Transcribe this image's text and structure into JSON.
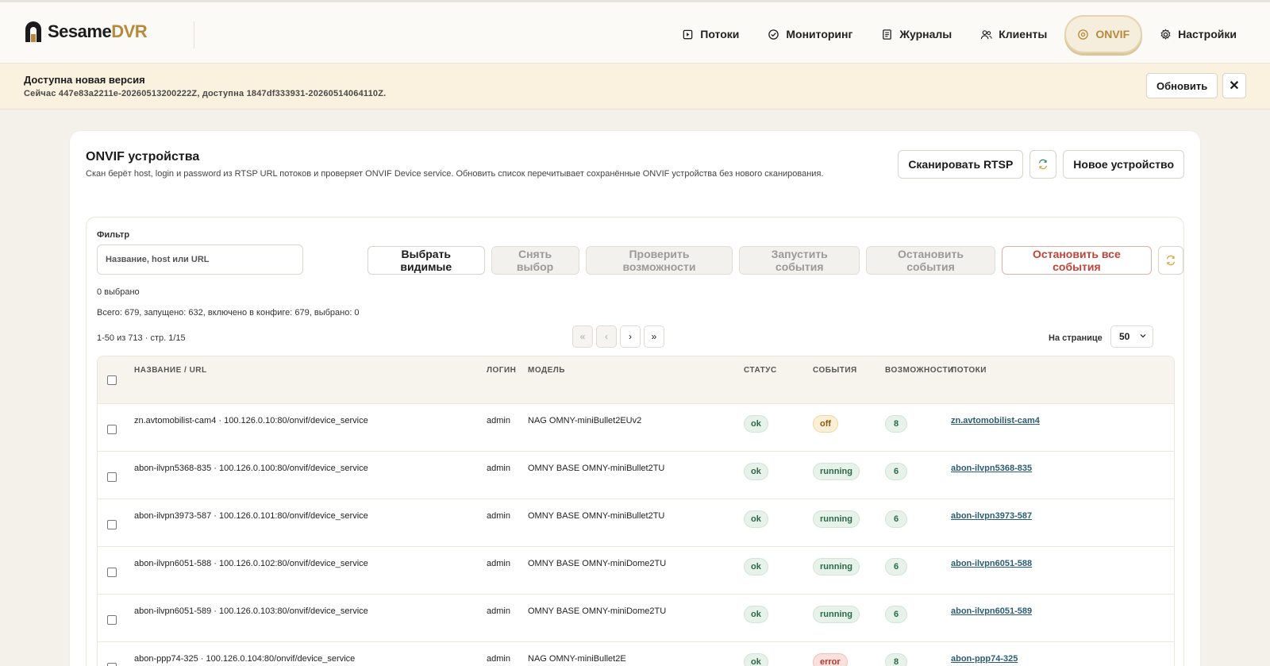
{
  "app": {
    "logo_main": "Sesame",
    "logo_accent": "DVR"
  },
  "nav": {
    "items": [
      {
        "label": "Потоки",
        "icon": "streams-icon"
      },
      {
        "label": "Мониторинг",
        "icon": "monitoring-icon"
      },
      {
        "label": "Журналы",
        "icon": "logs-icon"
      },
      {
        "label": "Клиенты",
        "icon": "clients-icon"
      },
      {
        "label": "ONVIF",
        "icon": "onvif-icon",
        "active": true
      },
      {
        "label": "Настройки",
        "icon": "settings-icon"
      }
    ]
  },
  "banner": {
    "title": "Доступна новая версия",
    "text": "Сейчас 447e83a2211e-20260513200222Z, доступна 1847df333931-20260514064110Z.",
    "update_label": "Обновить",
    "close_label": "✕"
  },
  "card": {
    "title": "ONVIF устройства",
    "description": "Скан берёт host, login и password из RTSP URL потоков и проверяет ONVIF Device service. Обновить список перечитывает сохранённые ONVIF устройства без нового сканирования.",
    "scan_label": "Сканировать RTSP",
    "refresh_icon": "refresh-icon",
    "new_device_label": "Новое устройство"
  },
  "filter": {
    "label": "Фильтр",
    "placeholder": "Название, host или URL",
    "select_visible": "Выбрать видимые",
    "clear_selection": "Снять выбор",
    "check_capabilities": "Проверить возможности",
    "start_events": "Запустить события",
    "stop_events": "Остановить события",
    "stop_all_events": "Остановить все события",
    "selected_count": "0 выбрано",
    "totals": "Всего: 679, запущено: 632, включено в конфиге: 679, выбрано: 0"
  },
  "pagination": {
    "range": "1-50 из 713 · стр. 1/15",
    "first": "«",
    "prev": "‹",
    "next": "›",
    "last": "»",
    "per_page_label": "На странице",
    "per_page_value": "50"
  },
  "table": {
    "headers": [
      "НАЗВАНИЕ / URL",
      "ЛОГИН",
      "МОДЕЛЬ",
      "СТАТУС",
      "СОБЫТИЯ",
      "ВОЗМОЖНОСТИ",
      "ПОТОКИ"
    ],
    "rows": [
      {
        "name": "zn.avtomobilist-cam4 · 100.126.0.10:80/onvif/device_service",
        "login": "admin",
        "model": "NAG OMNY-miniBullet2EUv2",
        "status": "ok",
        "events": "off",
        "caps": "8",
        "stream": "zn.avtomobilist-cam4"
      },
      {
        "name": "abon-ilvpn5368-835 · 100.126.0.100:80/onvif/device_service",
        "login": "admin",
        "model": "OMNY BASE OMNY-miniBullet2TU",
        "status": "ok",
        "events": "running",
        "caps": "6",
        "stream": "abon-ilvpn5368-835"
      },
      {
        "name": "abon-ilvpn3973-587 · 100.126.0.101:80/onvif/device_service",
        "login": "admin",
        "model": "OMNY BASE OMNY-miniBullet2TU",
        "status": "ok",
        "events": "running",
        "caps": "6",
        "stream": "abon-ilvpn3973-587"
      },
      {
        "name": "abon-ilvpn6051-588 · 100.126.0.102:80/onvif/device_service",
        "login": "admin",
        "model": "OMNY BASE OMNY-miniDome2TU",
        "status": "ok",
        "events": "running",
        "caps": "6",
        "stream": "abon-ilvpn6051-588"
      },
      {
        "name": "abon-ilvpn6051-589 · 100.126.0.103:80/onvif/device_service",
        "login": "admin",
        "model": "OMNY BASE OMNY-miniDome2TU",
        "status": "ok",
        "events": "running",
        "caps": "6",
        "stream": "abon-ilvpn6051-589"
      },
      {
        "name": "abon-ppp74-325 · 100.126.0.104:80/onvif/device_service",
        "login": "admin",
        "model": "NAG OMNY-miniBullet2E",
        "status": "ok",
        "events": "error",
        "caps": "8",
        "stream": "abon-ppp74-325"
      }
    ]
  },
  "colors": {
    "accent": "#b8893a",
    "background": "#f4f0ea",
    "danger": "#c0443a",
    "link": "#2a5d74"
  }
}
